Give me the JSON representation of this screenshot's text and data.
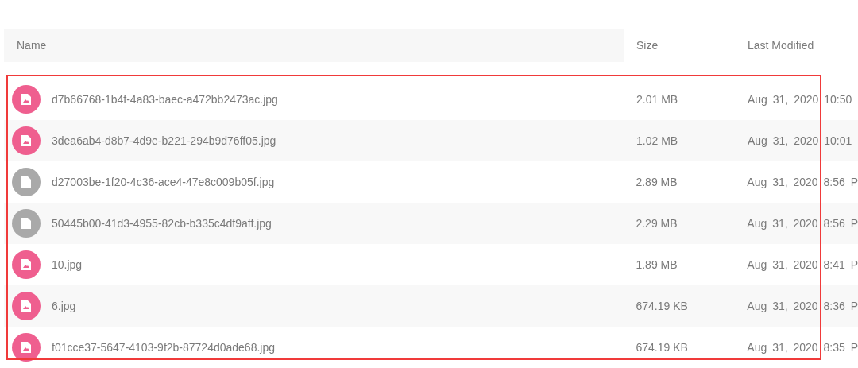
{
  "table": {
    "columns": [
      "Name",
      "Size",
      "Last Modified"
    ],
    "rows": [
      {
        "kind": "image",
        "name": "d7b66768-1b4f-4a83-baec-a472bb2473ac.jpg",
        "size": "2.01 MB",
        "modified": "Aug 31, 2020 10:50"
      },
      {
        "kind": "image",
        "name": "3dea6ab4-d8b7-4d9e-b221-294b9d76ff05.jpg",
        "size": "1.02 MB",
        "modified": "Aug 31, 2020 10:01"
      },
      {
        "kind": "file",
        "name": "d27003be-1f20-4c36-ace4-47e8c009b05f.jpg",
        "size": "2.89 MB",
        "modified": "Aug 31, 2020 8:56 P"
      },
      {
        "kind": "file",
        "name": "50445b00-41d3-4955-82cb-b335c4df9aff.jpg",
        "size": "2.29 MB",
        "modified": "Aug 31, 2020 8:56 P"
      },
      {
        "kind": "image",
        "name": "10.jpg",
        "size": "1.89 MB",
        "modified": "Aug 31, 2020 8:41 P"
      },
      {
        "kind": "image",
        "name": "6.jpg",
        "size": "674.19 KB",
        "modified": "Aug 31, 2020 8:36 P"
      },
      {
        "kind": "image",
        "name": "f01cce37-5647-4103-9f2b-87724d0ade68.jpg",
        "size": "674.19 KB",
        "modified": "Aug 31, 2020 8:35 P"
      }
    ]
  }
}
